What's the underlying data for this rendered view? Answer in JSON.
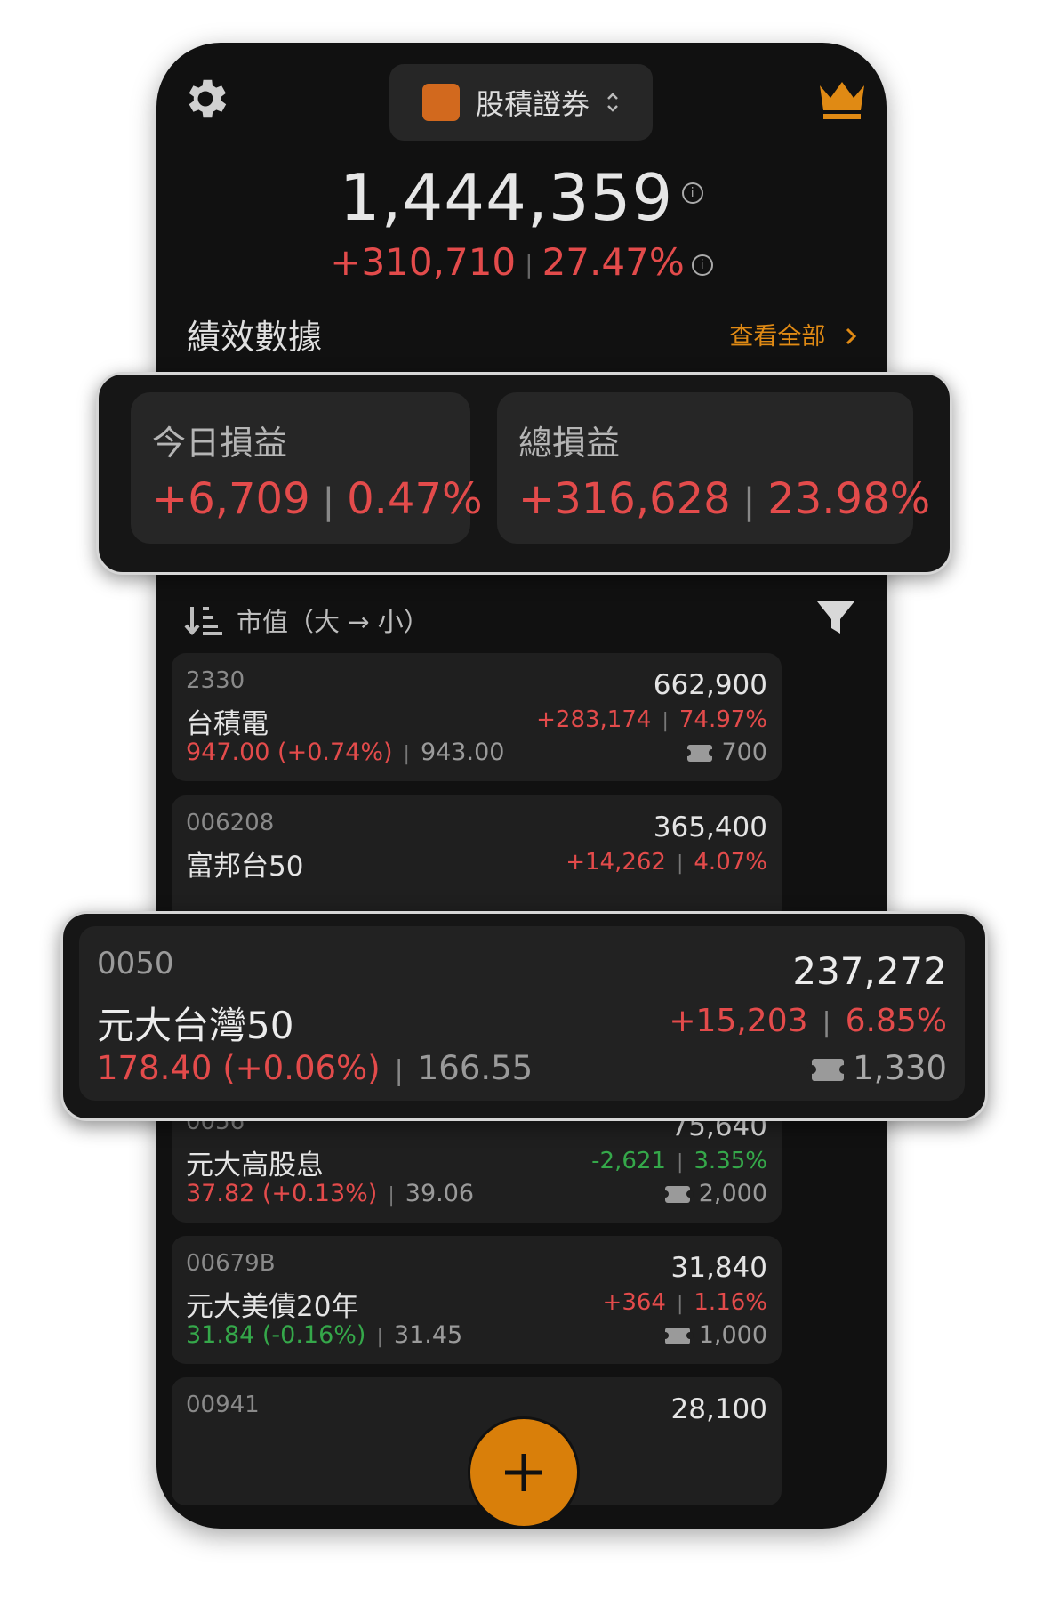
{
  "header": {
    "account_name": "股積證券",
    "account_switch_glyph": "⌃⌄",
    "settings_icon": "gear-icon",
    "premium_icon": "crown-icon"
  },
  "summary": {
    "total_value": "1,444,359",
    "gain_amount": "+310,710",
    "gain_percent": "27.47%",
    "info_glyph": "i"
  },
  "performance": {
    "title": "績效數據",
    "view_all": "查看全部",
    "today_label": "今日損益",
    "today_amount": "+6,709",
    "today_percent": "0.47%",
    "total_label": "總損益",
    "total_amount": "+316,628",
    "total_percent": "23.98%"
  },
  "sort": {
    "label": "市值（大 → 小）"
  },
  "holdings": [
    {
      "code": "2330",
      "name": "台積電",
      "price": "947.00 (+0.74%)",
      "cost": "943.00",
      "value": "662,900",
      "gain": "+283,174",
      "gain_pct": "74.97%",
      "shares": "700"
    },
    {
      "code": "006208",
      "name": "富邦台50",
      "price": "",
      "cost": "",
      "value": "365,400",
      "gain": "+14,262",
      "gain_pct": "4.07%",
      "shares": ""
    },
    {
      "code": "0050",
      "name": "元大台灣50",
      "price": "178.40 (+0.06%)",
      "cost": "166.55",
      "value": "237,272",
      "gain": "+15,203",
      "gain_pct": "6.85%",
      "shares": "1,330"
    },
    {
      "code": "0056",
      "name": "元大高股息",
      "price": "37.82 (+0.13%)",
      "cost": "39.06",
      "value": "75,640",
      "gain": "-2,621",
      "gain_pct": "3.35%",
      "shares": "2,000"
    },
    {
      "code": "00679B",
      "name": "元大美債20年",
      "price": "31.84 (-0.16%)",
      "cost": "31.45",
      "value": "31,840",
      "gain": "+364",
      "gain_pct": "1.16%",
      "shares": "1,000"
    },
    {
      "code": "00941",
      "name": "",
      "price": "",
      "cost": "",
      "value": "28,100",
      "gain": "",
      "gain_pct": "",
      "shares": ""
    }
  ],
  "colors": {
    "positive": "#e34b4b",
    "negative": "#35a84a",
    "accent": "#d97f0a"
  }
}
